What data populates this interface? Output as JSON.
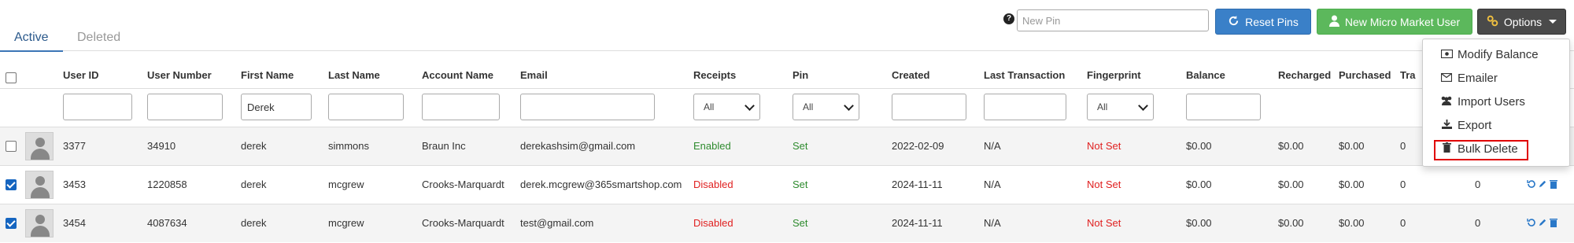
{
  "tabs": [
    {
      "label": "Active",
      "active": true
    },
    {
      "label": "Deleted",
      "active": false
    }
  ],
  "toolbar": {
    "help_label": "?",
    "pin_placeholder": "New Pin",
    "reset_label": "Reset Pins",
    "new_user_label": "New Micro Market User",
    "options_label": "Options"
  },
  "columns": {
    "user_id": "User ID",
    "user_number": "User Number",
    "first_name": "First Name",
    "last_name": "Last Name",
    "account_name": "Account Name",
    "email": "Email",
    "receipts": "Receipts",
    "pin": "Pin",
    "created": "Created",
    "last_transaction": "Last Transaction",
    "fingerprint": "Fingerprint",
    "balance": "Balance",
    "recharged": "Recharged",
    "purchased": "Purchased",
    "tra": "Tra"
  },
  "filters": {
    "first_name_value": "Derek",
    "receipts_selected": "All",
    "pin_selected": "All",
    "fingerprint_selected": "All"
  },
  "rows": [
    {
      "checked": false,
      "user_id": "3377",
      "user_number": "34910",
      "first_name": "derek",
      "last_name": "simmons",
      "account_name": "Braun Inc",
      "email": "derekashsim@gmail.com",
      "receipts": "Enabled",
      "pin": "Set",
      "created": "2022-02-09",
      "last_transaction": "N/A",
      "fingerprint": "Not Set",
      "balance": "$0.00",
      "recharged": "$0.00",
      "purchased": "$0.00",
      "tra": "0"
    },
    {
      "checked": true,
      "user_id": "3453",
      "user_number": "1220858",
      "first_name": "derek",
      "last_name": "mcgrew",
      "account_name": "Crooks-Marquardt",
      "email": "derek.mcgrew@365smartshop.com",
      "receipts": "Disabled",
      "pin": "Set",
      "created": "2024-11-11",
      "last_transaction": "N/A",
      "fingerprint": "Not Set",
      "balance": "$0.00",
      "recharged": "$0.00",
      "purchased": "$0.00",
      "tra": "0",
      "extra": "0"
    },
    {
      "checked": true,
      "user_id": "3454",
      "user_number": "4087634",
      "first_name": "derek",
      "last_name": "mcgrew",
      "account_name": "Crooks-Marquardt",
      "email": "test@gmail.com",
      "receipts": "Disabled",
      "pin": "Set",
      "created": "2024-11-11",
      "last_transaction": "N/A",
      "fingerprint": "Not Set",
      "balance": "$0.00",
      "recharged": "$0.00",
      "purchased": "$0.00",
      "tra": "0",
      "extra": "0"
    }
  ],
  "options_menu": [
    {
      "label": "Modify Balance",
      "icon": "money-icon"
    },
    {
      "label": "Emailer",
      "icon": "envelope-icon"
    },
    {
      "label": "Import Users",
      "icon": "users-icon"
    },
    {
      "label": "Export",
      "icon": "download-icon"
    },
    {
      "label": "Bulk Delete",
      "icon": "trash-icon"
    }
  ],
  "colors": {
    "primary": "#3a80c8",
    "success": "#5cb85c",
    "dark": "#4a4a4a",
    "enabled": "#2e8b2e",
    "disabled": "#e02020",
    "highlight": "#e00000"
  }
}
